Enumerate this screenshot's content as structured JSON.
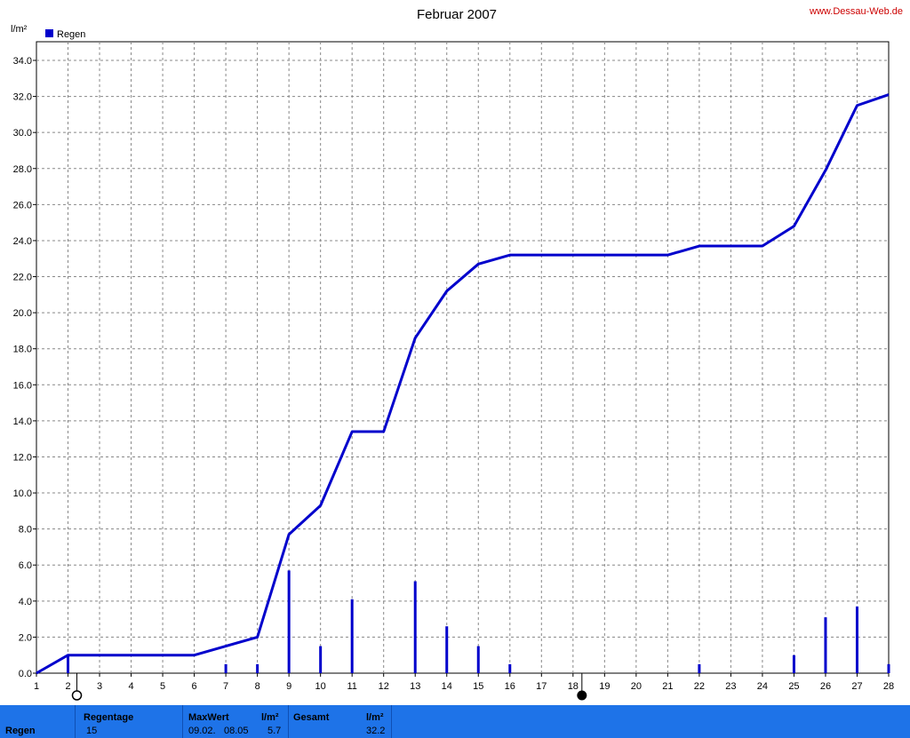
{
  "chart_data": {
    "type": "bar+line",
    "title": "Februar 2007",
    "ylabel": "l/m²",
    "site": "www.Dessau-Web.de",
    "legend": "Regen",
    "legend_position": "top-left",
    "color": "#0000cc",
    "ylim": [
      0,
      34
    ],
    "yticks": [
      "0.0",
      "2.0",
      "4.0",
      "6.0",
      "8.0",
      "10.0",
      "12.0",
      "14.0",
      "16.0",
      "18.0",
      "20.0",
      "22.0",
      "24.0",
      "26.0",
      "28.0",
      "30.0",
      "32.0",
      "34.0"
    ],
    "days": [
      1,
      2,
      3,
      4,
      5,
      6,
      7,
      8,
      9,
      10,
      11,
      12,
      13,
      14,
      15,
      16,
      17,
      18,
      19,
      20,
      21,
      22,
      23,
      24,
      25,
      26,
      27,
      28
    ],
    "daily": [
      0,
      1.0,
      0,
      0,
      0,
      0,
      0.5,
      0.5,
      5.7,
      1.5,
      4.1,
      0,
      5.1,
      2.6,
      1.5,
      0.5,
      0,
      0,
      0,
      0,
      0,
      0.5,
      0,
      0,
      1.0,
      3.1,
      3.7,
      0.5
    ],
    "cumulative": [
      0,
      1.0,
      1.0,
      1.0,
      1.0,
      1.0,
      1.5,
      2.0,
      7.7,
      9.3,
      13.4,
      13.4,
      18.6,
      21.2,
      22.7,
      23.2,
      23.2,
      23.2,
      23.2,
      23.2,
      23.2,
      23.7,
      23.7,
      23.7,
      24.8,
      27.9,
      31.5,
      32.1
    ],
    "grid": true,
    "moon_phases": [
      {
        "day": 2,
        "phase": "full-moon"
      },
      {
        "day": 18,
        "phase": "new-moon"
      }
    ]
  },
  "summary": {
    "row_label": "Regen",
    "regentage_label": "Regentage",
    "regentage_value": "15",
    "maxwert_label": "MaxWert",
    "maxwert_unit": "l/m²",
    "maxwert_dates": "09.02.",
    "maxwert_time": "08.05",
    "maxwert_value": "5.7",
    "gesamt_label": "Gesamt",
    "gesamt_unit": "l/m²",
    "gesamt_value": "32.2"
  }
}
